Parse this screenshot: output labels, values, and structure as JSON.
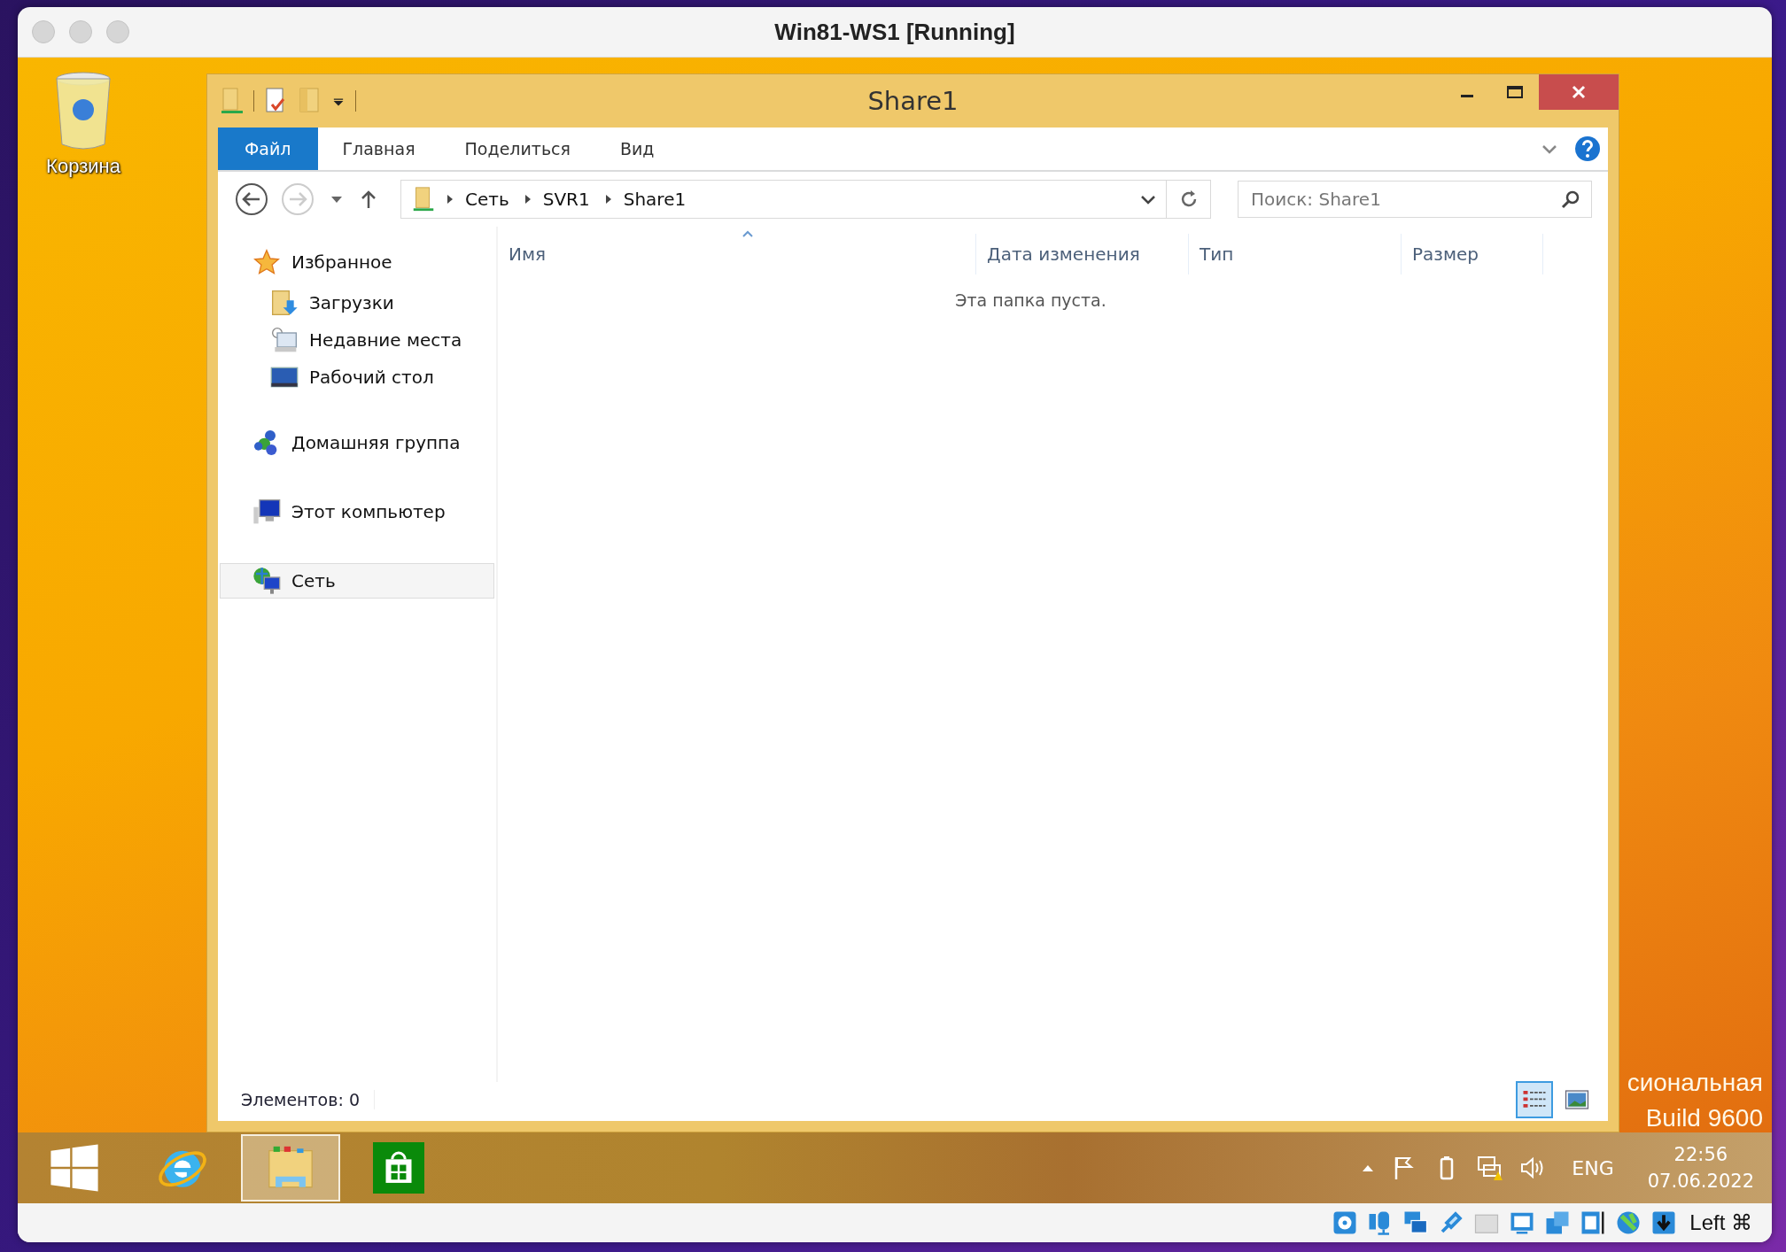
{
  "host_window": {
    "title": "Win81-WS1 [Running]"
  },
  "desktop": {
    "icons": [
      {
        "kind": "recycle-bin",
        "label": "Корзина"
      }
    ],
    "watermark": [
      "сиональная",
      "Build 9600"
    ]
  },
  "explorer": {
    "title": "Share1",
    "ribbon_tabs": [
      {
        "label": "Файл",
        "selected": true
      },
      {
        "label": "Главная",
        "selected": false
      },
      {
        "label": "Поделиться",
        "selected": false
      },
      {
        "label": "Вид",
        "selected": false
      }
    ],
    "breadcrumbs": [
      "Сеть",
      "SVR1",
      "Share1"
    ],
    "search": {
      "placeholder": "Поиск: Share1"
    },
    "nav": [
      {
        "kind": "favorites",
        "label": "Избранное",
        "selected": false,
        "children": [
          {
            "kind": "downloads",
            "label": "Загрузки",
            "selected": false
          },
          {
            "kind": "recent",
            "label": "Недавние места",
            "selected": false
          },
          {
            "kind": "desktop",
            "label": "Рабочий стол",
            "selected": false
          }
        ]
      },
      {
        "kind": "homegroup",
        "label": "Домашняя группа",
        "selected": false
      },
      {
        "kind": "computer",
        "label": "Этот компьютер",
        "selected": false
      },
      {
        "kind": "network",
        "label": "Сеть",
        "selected": true
      }
    ],
    "columns": [
      "Имя",
      "Дата изменения",
      "Тип",
      "Размер"
    ],
    "empty_message": "Эта папка пуста.",
    "status": "Элементов: 0",
    "view_buttons": [
      {
        "kind": "details",
        "selected": true
      },
      {
        "kind": "tiles",
        "selected": false
      }
    ]
  },
  "taskbar": {
    "apps": [
      {
        "kind": "start",
        "selected": false
      },
      {
        "kind": "browser",
        "selected": false
      },
      {
        "kind": "explorer",
        "selected": true
      },
      {
        "kind": "store",
        "selected": false
      }
    ],
    "tray": {
      "language": "ENG",
      "time": "22:56",
      "date": "07.06.2022"
    }
  },
  "vm_status_bar": {
    "host_key": "Left ⌘"
  }
}
